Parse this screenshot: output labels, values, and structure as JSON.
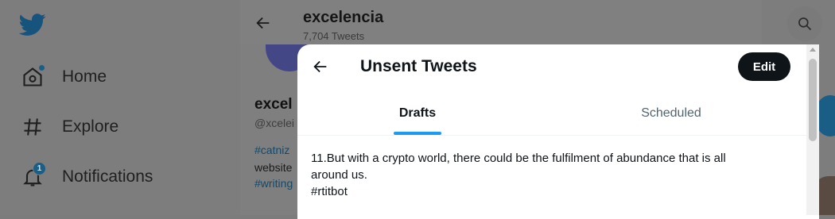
{
  "sidebar": {
    "items": [
      {
        "label": "Home",
        "icon": "home-icon"
      },
      {
        "label": "Explore",
        "icon": "hashtag-icon"
      },
      {
        "label": "Notifications",
        "icon": "bell-icon",
        "badge": "1"
      }
    ]
  },
  "profile": {
    "name_top": "excelencia",
    "tweet_count": "7,704 Tweets",
    "name_partial": "excel",
    "handle_partial": "@xcelei",
    "hashtag1_partial": "#catniz",
    "bio_partial": "website",
    "hashtag2_partial": "#writing"
  },
  "modal": {
    "title": "Unsent Tweets",
    "edit_label": "Edit",
    "tabs": [
      {
        "label": "Drafts",
        "active": true
      },
      {
        "label": "Scheduled",
        "active": false
      }
    ],
    "drafts": [
      {
        "lines": [
          "11.But with a crypto world, there could be the fulfilment of abundance that is all",
          "around us.",
          "#rtitbot"
        ]
      }
    ]
  },
  "colors": {
    "accent": "#1d9bf0",
    "edit_button": "#0f1419",
    "overlay_bg": "#7c7c7c"
  }
}
